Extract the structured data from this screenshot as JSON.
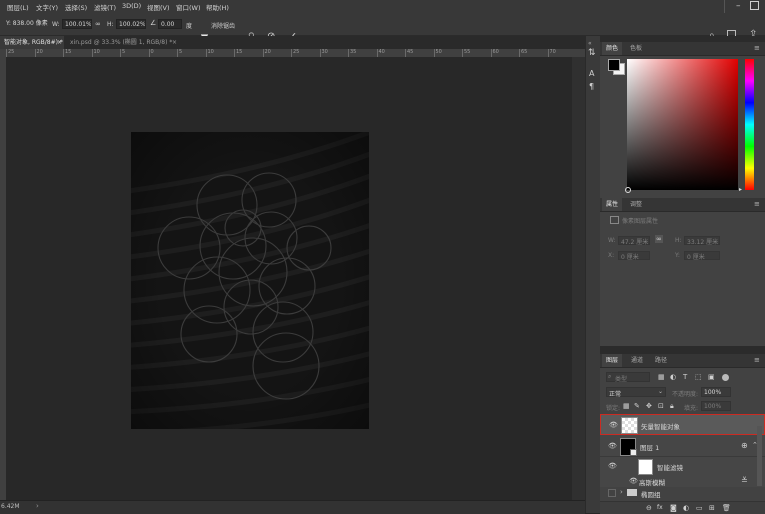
{
  "menubar": {
    "items": [
      "图层(L)",
      "文字(Y)",
      "选择(S)",
      "滤镜(T)",
      "3D(D)",
      "视图(V)",
      "窗口(W)",
      "帮助(H)"
    ]
  },
  "options": {
    "y_value": "Y: 838.00 像素",
    "w_label": "W:",
    "w_value": "100.01%",
    "h_label": "H:",
    "h_value": "100.02%",
    "angle_value": "0.00",
    "interp_label": "度",
    "antialias_label": "消除锯齿"
  },
  "tabs": {
    "active": "智能对象, RGB/8#) *",
    "second": "xin.psd @ 33.3% (椭圆 1, RGB/8) *"
  },
  "ruler_ticks": [
    "25",
    "20",
    "15",
    "10",
    "5",
    "0",
    "5",
    "10",
    "15",
    "20",
    "25",
    "30",
    "35",
    "40",
    "45",
    "50",
    "55",
    "60",
    "65",
    "70"
  ],
  "status": {
    "doc_size": "6.42M"
  },
  "color_panel": {
    "tab_color": "颜色",
    "tab_swatches": "色板"
  },
  "properties_panel": {
    "tab_properties": "属性",
    "tab_adjust": "调整",
    "label": "像素图层属性",
    "w_label": "W:",
    "w_value": "47.2 厘米",
    "h_label": "H:",
    "h_value": "33.12 厘米",
    "x_label": "X:",
    "x_value": "0 厘米",
    "y_label": "Y:",
    "y_value": "0 厘米"
  },
  "layers_panel": {
    "tab_layers": "图层",
    "tab_channels": "通道",
    "tab_paths": "路径",
    "filter_kind": "类型",
    "blend_mode": "正常",
    "opacity_label": "不透明度:",
    "opacity_value": "100%",
    "lock_label": "锁定:",
    "fill_label": "填充:",
    "fill_value": "100%",
    "layers": [
      {
        "name": "矢量智能对象"
      },
      {
        "name": "图层 1"
      },
      {
        "name": "智能滤镜"
      },
      {
        "name": "高斯模糊"
      },
      {
        "name": "椭圆组"
      }
    ]
  },
  "colors": {
    "accent_red": "#d33a2c",
    "selection_outline": "#cc2b22"
  }
}
